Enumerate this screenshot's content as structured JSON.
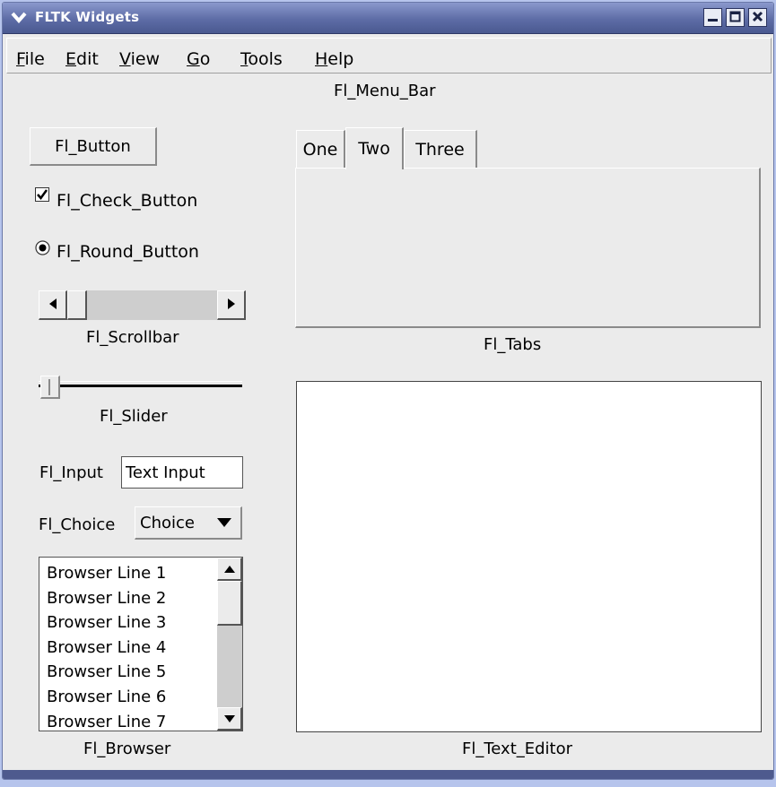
{
  "window": {
    "title": "FLTK Widgets"
  },
  "menubar": {
    "items": [
      {
        "label": "File",
        "mnemonic": "F",
        "rest": "ile"
      },
      {
        "label": "Edit",
        "mnemonic": "E",
        "rest": "dit"
      },
      {
        "label": "View",
        "mnemonic": "V",
        "rest": "iew"
      },
      {
        "label": "Go",
        "mnemonic": "G",
        "rest": "o"
      },
      {
        "label": "Tools",
        "mnemonic": "T",
        "rest": "ools"
      },
      {
        "label": "Help",
        "mnemonic": "H",
        "rest": "elp"
      }
    ],
    "caption": "Fl_Menu_Bar"
  },
  "button": {
    "label": "Fl_Button"
  },
  "check_button": {
    "label": "Fl_Check_Button",
    "checked": true
  },
  "round_button": {
    "label": "Fl_Round_Button",
    "selected": true
  },
  "scrollbar": {
    "caption": "Fl_Scrollbar",
    "value": 0
  },
  "slider": {
    "caption": "Fl_Slider",
    "value": 0
  },
  "input": {
    "label": "Fl_Input",
    "value": "Text Input"
  },
  "choice": {
    "label": "Fl_Choice",
    "value": "Choice"
  },
  "browser": {
    "caption": "Fl_Browser",
    "lines": [
      "Browser Line 1",
      "Browser Line 2",
      "Browser Line 3",
      "Browser Line 4",
      "Browser Line 5",
      "Browser Line 6",
      "Browser Line 7"
    ]
  },
  "tabs": {
    "caption": "Fl_Tabs",
    "items": [
      {
        "label": "One"
      },
      {
        "label": "Two"
      },
      {
        "label": "Three"
      }
    ],
    "active": "Two"
  },
  "text_editor": {
    "caption": "Fl_Text_Editor"
  },
  "colors": {
    "titlebar": "#5d6ca6",
    "desktop": "#b6c4ec",
    "window_bg": "#ebebeb"
  }
}
